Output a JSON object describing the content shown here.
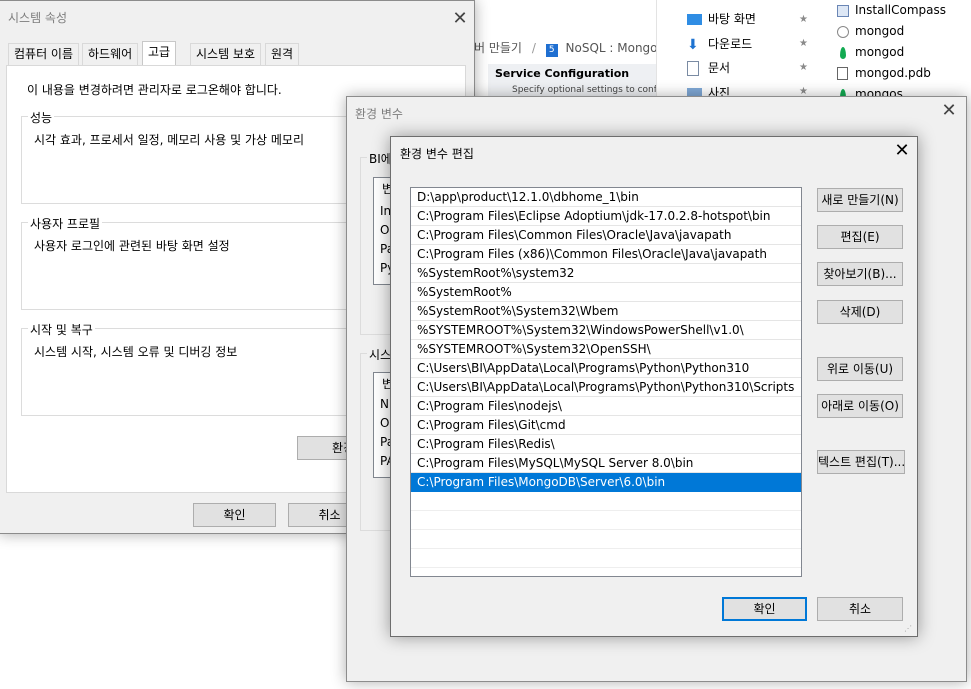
{
  "explorer": {
    "quick_items": [
      {
        "label": "바탕 화면",
        "icon": "desktop-icon"
      },
      {
        "label": "다운로드",
        "icon": "download-icon"
      },
      {
        "label": "문서",
        "icon": "document-icon"
      },
      {
        "label": "사진",
        "icon": "picture-icon"
      }
    ],
    "files": [
      {
        "label": "InstallCompass",
        "icon": "app-icon"
      },
      {
        "label": "mongod",
        "icon": "config-file-icon"
      },
      {
        "label": "mongod",
        "icon": "mongodb-leaf-icon"
      },
      {
        "label": "mongod.pdb",
        "icon": "pdb-file-icon"
      },
      {
        "label": "mongos",
        "icon": "mongodb-leaf-icon"
      }
    ]
  },
  "browser": {
    "breadcrumb_a": "버 만들기",
    "breadcrumb_sep": "/",
    "breadcrumb_badge": "5",
    "breadcrumb_b": "NoSQL : Mongo",
    "section_title": "Service Configuration",
    "section_sub": "Specify optional settings to confi"
  },
  "sysprops": {
    "title": "시스템 속성",
    "tabs": [
      "컴퓨터 이름",
      "하드웨어",
      "고급",
      "시스템 보호",
      "원격"
    ],
    "active_tab": 2,
    "admin_notice": "이 내용을 변경하려면 관리자로 로그온해야 합니다.",
    "groups": [
      {
        "legend": "성능",
        "desc": "시각 효과, 프로세서 일정, 메모리 사용 및 가상 메모리"
      },
      {
        "legend": "사용자 프로필",
        "desc": "사용자 로그인에 관련된 바탕 화면 설정"
      },
      {
        "legend": "시작 및 복구",
        "desc": "시스템 시작, 시스템 오류 및 디버깅 정보"
      }
    ],
    "env_button": "환경",
    "ok": "확인",
    "cancel": "취소"
  },
  "envvars": {
    "title": "환경 변수",
    "user_group_legend": "BI에",
    "user_col": "변",
    "user_rows": [
      "Int",
      "On",
      "Pa",
      "Py"
    ],
    "sys_group_legend": "시스",
    "sys_col": "변",
    "sys_rows": [
      "NU",
      "OS",
      "Pa",
      "PA"
    ]
  },
  "editenv": {
    "title": "환경 변수 편집",
    "paths": [
      "D:\\app\\product\\12.1.0\\dbhome_1\\bin",
      "C:\\Program Files\\Eclipse Adoptium\\jdk-17.0.2.8-hotspot\\bin",
      "C:\\Program Files\\Common Files\\Oracle\\Java\\javapath",
      "C:\\Program Files (x86)\\Common Files\\Oracle\\Java\\javapath",
      "%SystemRoot%\\system32",
      "%SystemRoot%",
      "%SystemRoot%\\System32\\Wbem",
      "%SYSTEMROOT%\\System32\\WindowsPowerShell\\v1.0\\",
      "%SYSTEMROOT%\\System32\\OpenSSH\\",
      "C:\\Users\\BI\\AppData\\Local\\Programs\\Python\\Python310",
      "C:\\Users\\BI\\AppData\\Local\\Programs\\Python\\Python310\\Scripts",
      "C:\\Program Files\\nodejs\\",
      "C:\\Program Files\\Git\\cmd",
      "C:\\Program Files\\Redis\\",
      "C:\\Program Files\\MySQL\\MySQL Server 8.0\\bin",
      "C:\\Program Files\\MongoDB\\Server\\6.0\\bin"
    ],
    "selected_index": 15,
    "buttons": {
      "new": "새로 만들기(N)",
      "edit": "편집(E)",
      "browse": "찾아보기(B)...",
      "delete": "삭제(D)",
      "move_up": "위로 이동(U)",
      "move_down": "아래로 이동(O)",
      "edit_text": "텍스트 편집(T)..."
    },
    "ok": "확인",
    "cancel": "취소"
  },
  "colors": {
    "selection": "#0078d7",
    "dialog_bg": "#f0f0f0",
    "button_bg": "#e1e1e1"
  }
}
